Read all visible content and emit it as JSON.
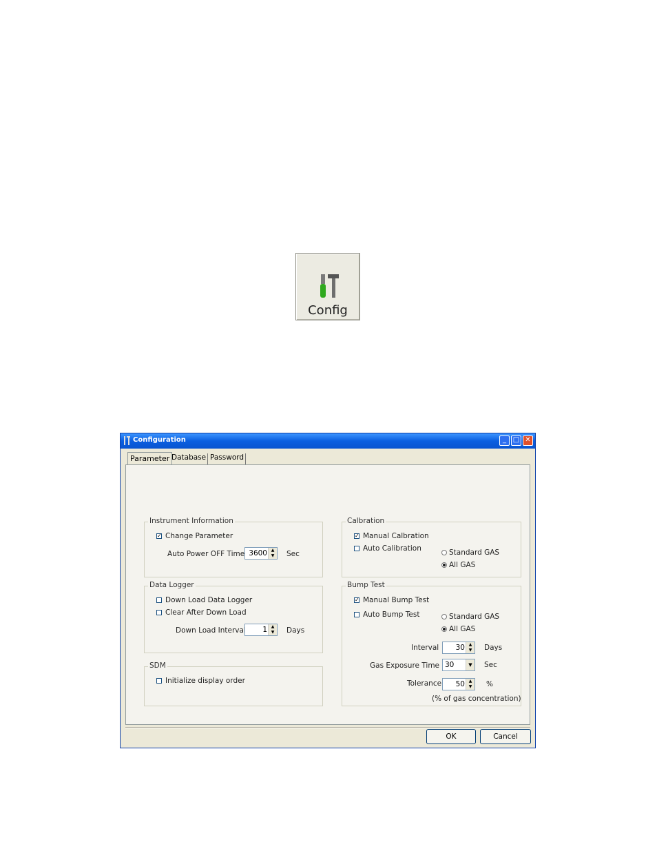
{
  "toolbar": {
    "config_label": "Config"
  },
  "dialog": {
    "title": "Configuration",
    "tabs": [
      "Parameter",
      "Database",
      "Password"
    ],
    "instrument": {
      "caption": "Instrument Information",
      "change_param": "Change Parameter",
      "auto_power_label": "Auto Power OFF Time",
      "auto_power_value": "3600",
      "auto_power_unit": "Sec"
    },
    "datalogger": {
      "caption": "Data Logger",
      "download": "Down Load Data Logger",
      "clear": "Clear After Down Load",
      "interval_label": "Down Load Interval",
      "interval_value": "1",
      "interval_unit": "Days"
    },
    "sdm": {
      "caption": "SDM",
      "init": "Initialize display order"
    },
    "calibration": {
      "caption": "Calbration",
      "manual": "Manual Calbration",
      "auto": "Auto Calibration",
      "standard": "Standard GAS",
      "all": "All GAS"
    },
    "bump": {
      "caption": "Bump Test",
      "manual": "Manual Bump Test",
      "auto": "Auto Bump Test",
      "standard": "Standard GAS",
      "all": "All GAS",
      "interval_label": "Interval",
      "interval_value": "30",
      "interval_unit": "Days",
      "exposure_label": "Gas Exposure Time",
      "exposure_value": "30",
      "exposure_unit": "Sec",
      "tolerance_label": "Tolerance",
      "tolerance_value": "50",
      "tolerance_unit": "%",
      "note": "(% of gas concentration)"
    },
    "ok": "OK",
    "cancel": "Cancel"
  },
  "colors": {
    "titlebar": "#0a5fe0",
    "dialog_bg": "#ece9d8",
    "close": "#e0502a"
  }
}
